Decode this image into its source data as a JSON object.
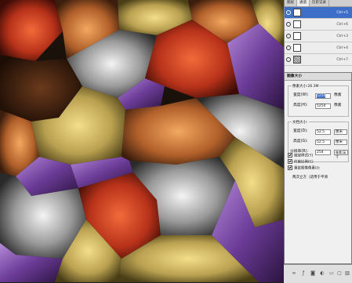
{
  "panel": {
    "tabs": [
      "图层",
      "通道",
      "历史记录"
    ],
    "layers": [
      {
        "name": "",
        "shortcut": "Ctrl+5",
        "selected": true,
        "thumb": "white"
      },
      {
        "name": "",
        "shortcut": "Ctrl+6",
        "selected": false,
        "thumb": "white"
      },
      {
        "name": "",
        "shortcut": "Ctrl+3",
        "selected": false,
        "thumb": "white"
      },
      {
        "name": "",
        "shortcut": "Ctrl+4",
        "selected": false,
        "thumb": "white"
      },
      {
        "name": "",
        "shortcut": "Ctrl+7",
        "selected": false,
        "thumb": "noise"
      }
    ]
  },
  "dialog": {
    "title": "图像大小",
    "pixel_group": {
      "title": "像素大小:26.3M",
      "width_label": "宽度(W):",
      "width_value": "5250",
      "width_unit": "像素",
      "height_label": "高度(H):",
      "height_value": "5250",
      "height_unit": "像素"
    },
    "doc_group": {
      "title": "文档大小:",
      "width_label": "宽度(D):",
      "width_value": "52.5",
      "width_unit": "厘米",
      "height_label": "高度(G):",
      "height_value": "52.5",
      "height_unit": "厘米",
      "res_label": "分辨率(R):",
      "res_value": "254",
      "res_unit": "像素/英寸"
    },
    "checkboxes": [
      "缩放样式(Y)",
      "约束比例(C)",
      "重定图像像素(I):"
    ],
    "interpolation": "两次立方（适用于平滑"
  },
  "colors": {
    "selected_layer": "#3d6fc8",
    "panel_bg": "#ededed"
  }
}
